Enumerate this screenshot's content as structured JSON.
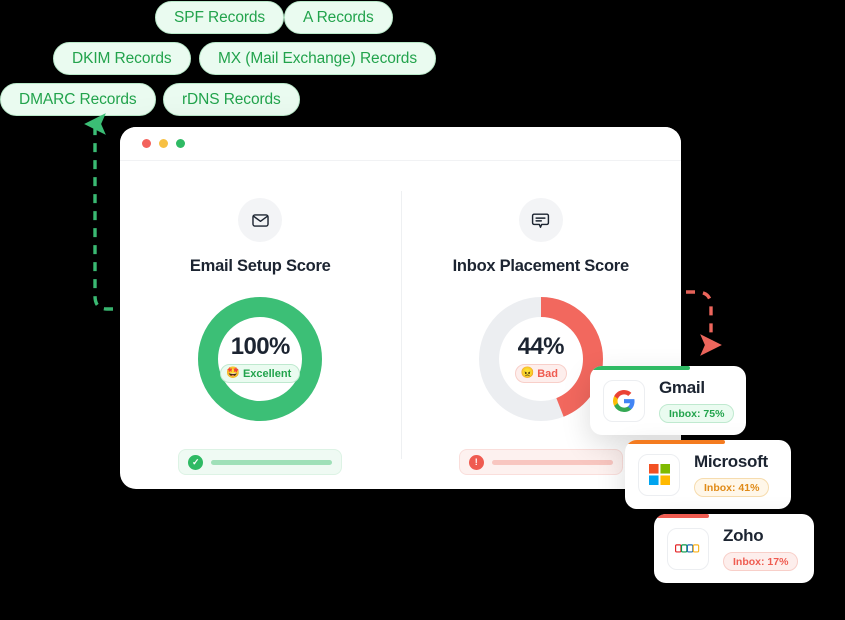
{
  "record_pills": [
    {
      "id": "spf",
      "label": "SPF Records"
    },
    {
      "id": "a",
      "label": "A Records"
    },
    {
      "id": "dkim",
      "label": "DKIM Records"
    },
    {
      "id": "mx",
      "label": "MX (Mail Exchange) Records"
    },
    {
      "id": "dmarc",
      "label": "DMARC Records"
    },
    {
      "id": "rdns",
      "label": "rDNS Records"
    }
  ],
  "main_card": {
    "window_dots": [
      "red",
      "yellow",
      "green"
    ],
    "panels": [
      {
        "icon": "envelope-icon",
        "title": "Email Setup Score",
        "value": "100%",
        "percent": 100,
        "badge_label": "Excellent",
        "badge_emoji": "🤩",
        "badge_tone": "good",
        "arc_color": "#3cbf76",
        "track_color": "#eceef1",
        "bar_tone": "good",
        "bar_icon": "check-icon"
      },
      {
        "icon": "chat-bubble-icon",
        "title": "Inbox Placement Score",
        "value": "44%",
        "percent": 44,
        "badge_label": "Bad",
        "badge_emoji": "😠",
        "badge_tone": "bad",
        "arc_color": "#f2685e",
        "track_color": "#eceef1",
        "bar_tone": "bad",
        "bar_icon": "alert-icon"
      }
    ]
  },
  "providers": [
    {
      "id": "gmail",
      "name": "Gmail",
      "logo": "google-g-icon",
      "inbox_label": "Inbox: 75%",
      "inbox_percent": 75,
      "badge_tone": "green",
      "accent_color": "#2fba64"
    },
    {
      "id": "microsoft",
      "name": "Microsoft",
      "logo": "microsoft-squares-icon",
      "inbox_label": "Inbox: 41%",
      "inbox_percent": 41,
      "badge_tone": "orange",
      "accent_color": "#f47b20"
    },
    {
      "id": "zoho",
      "name": "Zoho",
      "logo": "zoho-icon",
      "inbox_label": "Inbox: 17%",
      "inbox_percent": 17,
      "badge_tone": "red",
      "accent_color": "#ef5b50"
    }
  ],
  "connectors": [
    {
      "id": "setup-to-records",
      "color": "#3cbf76",
      "style": "dashed",
      "direction": "up-left"
    },
    {
      "id": "placement-to-providers",
      "color": "#f2685e",
      "style": "dashed",
      "direction": "right-down"
    }
  ],
  "colors": {
    "green": "#3cbf76",
    "red": "#f2685e",
    "orange": "#f47b20",
    "pill_bg": "#eafbf0",
    "pill_text": "#22a34c",
    "text_dark": "#1c2431",
    "background": "#000000"
  }
}
